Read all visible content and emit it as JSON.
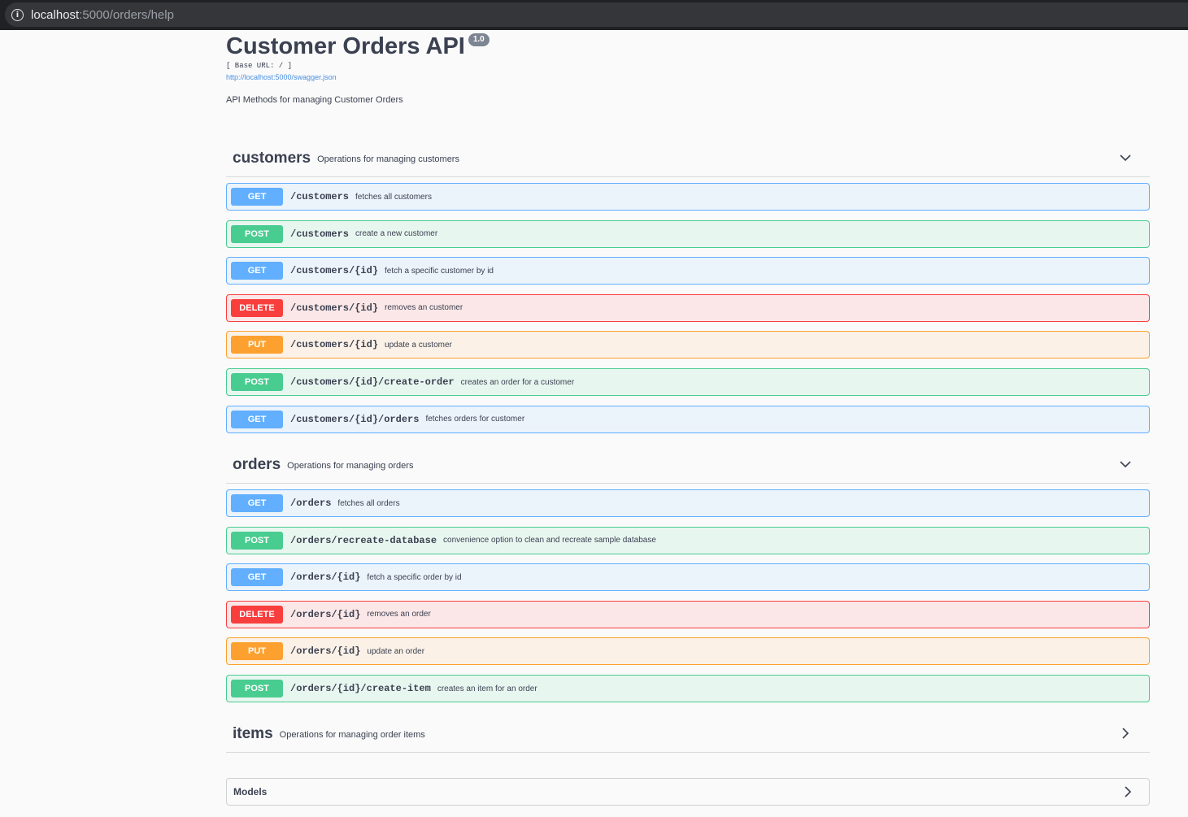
{
  "browser": {
    "url_host": "localhost",
    "url_path": ":5000/orders/help"
  },
  "info": {
    "title": "Customer Orders API",
    "version": "1.0",
    "base_url": "[ Base URL: / ]",
    "spec_link": "http://localhost:5000/swagger.json",
    "description": "API Methods for managing Customer Orders"
  },
  "tags": [
    {
      "name": "customers",
      "description": "Operations for managing customers",
      "expanded": true,
      "operations": [
        {
          "method": "GET",
          "path": "/customers",
          "summary": "fetches all customers"
        },
        {
          "method": "POST",
          "path": "/customers",
          "summary": "create a new customer"
        },
        {
          "method": "GET",
          "path": "/customers/{id}",
          "summary": "fetch a specific customer by id"
        },
        {
          "method": "DELETE",
          "path": "/customers/{id}",
          "summary": "removes an customer"
        },
        {
          "method": "PUT",
          "path": "/customers/{id}",
          "summary": "update a customer"
        },
        {
          "method": "POST",
          "path": "/customers/{id}/create-order",
          "summary": "creates an order for a customer"
        },
        {
          "method": "GET",
          "path": "/customers/{id}/orders",
          "summary": "fetches orders for customer"
        }
      ]
    },
    {
      "name": "orders",
      "description": "Operations for managing orders",
      "expanded": true,
      "operations": [
        {
          "method": "GET",
          "path": "/orders",
          "summary": "fetches all orders"
        },
        {
          "method": "POST",
          "path": "/orders/recreate-database",
          "summary": "convenience option to clean and recreate sample database"
        },
        {
          "method": "GET",
          "path": "/orders/{id}",
          "summary": "fetch a specific order by id"
        },
        {
          "method": "DELETE",
          "path": "/orders/{id}",
          "summary": "removes an order"
        },
        {
          "method": "PUT",
          "path": "/orders/{id}",
          "summary": "update an order"
        },
        {
          "method": "POST",
          "path": "/orders/{id}/create-item",
          "summary": "creates an item for an order"
        }
      ]
    },
    {
      "name": "items",
      "description": "Operations for managing order items",
      "expanded": false,
      "operations": []
    }
  ],
  "models": {
    "label": "Models"
  },
  "colors": {
    "get": "#61affe",
    "post": "#49cc90",
    "delete": "#f93e3e",
    "put": "#fca130"
  }
}
